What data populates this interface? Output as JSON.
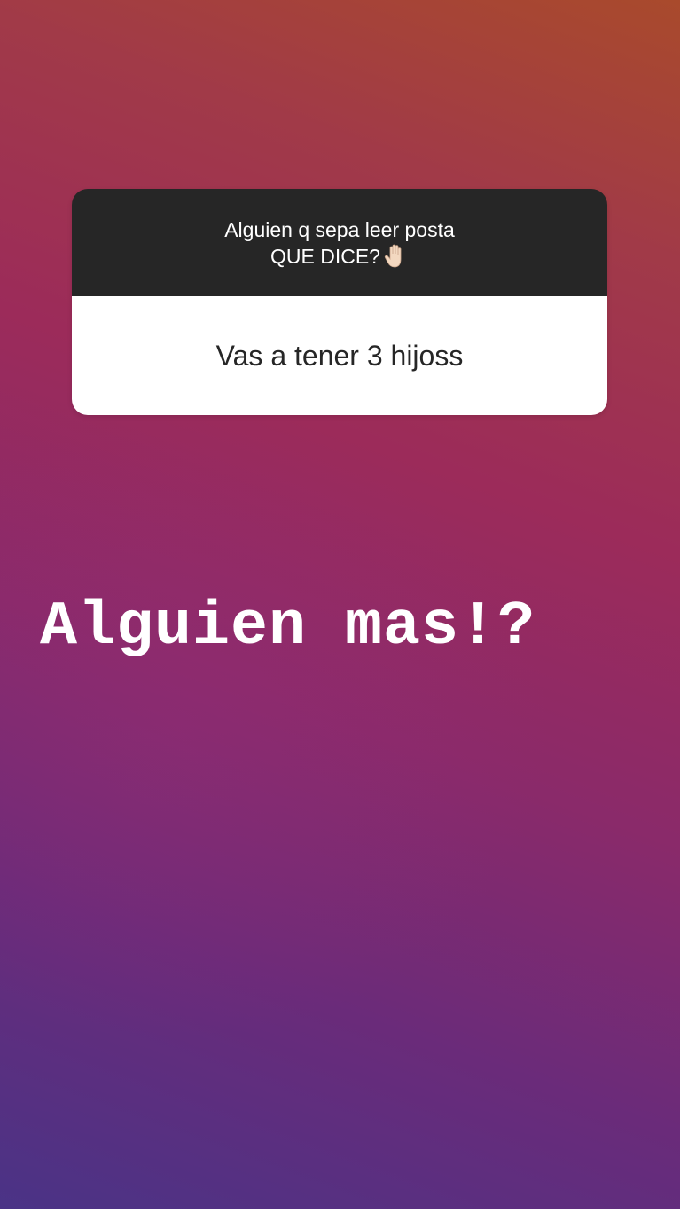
{
  "question_sticker": {
    "question_line1": "Alguien q sepa leer posta",
    "question_line2": "QUE DICE?",
    "question_emoji": "raised-hand-icon",
    "answer": "Vas a tener 3 hijoss"
  },
  "caption": {
    "text": "Alguien mas!?"
  },
  "colors": {
    "background_top": "#a94a2c",
    "background_middle": "#9c2b5a",
    "background_bottom": "#4a3386",
    "card_header": "#262626",
    "card_body": "#ffffff",
    "caption_text": "#ffffff"
  }
}
